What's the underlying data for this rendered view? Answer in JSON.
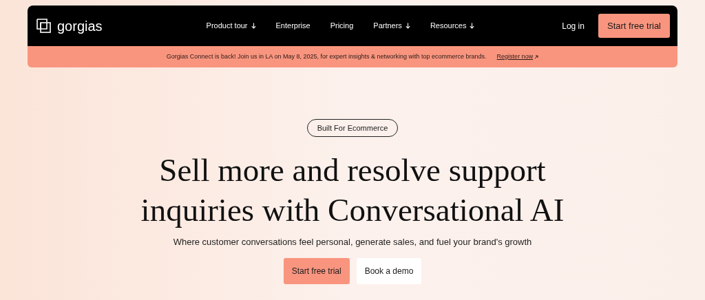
{
  "header": {
    "logo": "gorgias",
    "nav": [
      {
        "label": "Product tour",
        "has_menu": true
      },
      {
        "label": "Enterprise",
        "has_menu": false
      },
      {
        "label": "Pricing",
        "has_menu": false
      },
      {
        "label": "Partners",
        "has_menu": true
      },
      {
        "label": "Resources",
        "has_menu": true
      }
    ],
    "login": "Log in",
    "cta": "Start free trial"
  },
  "banner": {
    "text": "Gorgias Connect is back! Join us in LA on May 8, 2025, for expert insights & networking with top ecommerce brands.",
    "link": "Register now"
  },
  "hero": {
    "badge": "Built For Ecommerce",
    "headline_lines": [
      "Sell more and resolve support",
      "inquiries with Conversational AI"
    ],
    "subtitle": "Where customer conversations feel personal, generate sales, and fuel your brand's growth",
    "buttons": [
      {
        "label": "Start free trial",
        "kind": "primary"
      },
      {
        "label": "Book a demo",
        "kind": "secondary"
      }
    ]
  }
}
